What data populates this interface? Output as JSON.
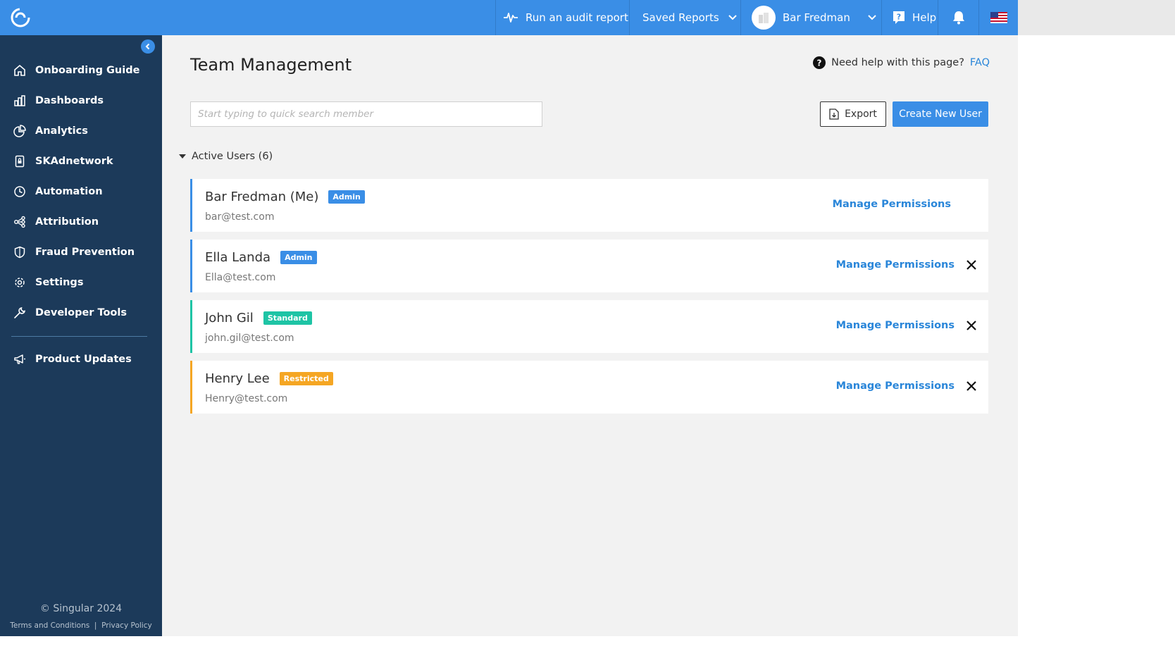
{
  "colors": {
    "brand": "#3a8ee6",
    "sidebar": "#1c3a5a",
    "admin": "#3a8ee6",
    "standard": "#1ec4a5",
    "restricted": "#f5a623",
    "link": "#2a86d9"
  },
  "topbar": {
    "audit_label": "Run an audit report",
    "saved_reports_label": "Saved Reports",
    "user_name": "Bar Fredman",
    "help_label": "Help"
  },
  "sidebar": {
    "items": [
      {
        "label": "Onboarding Guide",
        "icon": "home-icon"
      },
      {
        "label": "Dashboards",
        "icon": "bar-chart-icon"
      },
      {
        "label": "Analytics",
        "icon": "pie-chart-icon"
      },
      {
        "label": "SKAdnetwork",
        "icon": "lock-device-icon"
      },
      {
        "label": "Automation",
        "icon": "clock-icon"
      },
      {
        "label": "Attribution",
        "icon": "share-nodes-icon"
      },
      {
        "label": "Fraud Prevention",
        "icon": "shield-icon"
      },
      {
        "label": "Settings",
        "icon": "gear-icon"
      },
      {
        "label": "Developer Tools",
        "icon": "wrench-icon"
      }
    ],
    "updates_label": "Product Updates",
    "copyright": "© Singular 2024",
    "terms": "Terms and Conditions",
    "separator": "|",
    "privacy": "Privacy Policy"
  },
  "main": {
    "title": "Team Management",
    "help_text": "Need help with this page?",
    "faq": "FAQ",
    "search_placeholder": "Start typing to quick search member",
    "export_label": "Export",
    "create_label": "Create New User",
    "section_label": "Active Users (6)",
    "manage_label": "Manage Permissions",
    "users": [
      {
        "name": "Bar Fredman (Me)",
        "email": "bar@test.com",
        "role": "Admin",
        "color": "#3a8ee6",
        "removable": false
      },
      {
        "name": "Ella Landa",
        "email": "Ella@test.com",
        "role": "Admin",
        "color": "#3a8ee6",
        "removable": true
      },
      {
        "name": "John Gil",
        "email": "john.gil@test.com",
        "role": "Standard",
        "color": "#1ec4a5",
        "removable": true
      },
      {
        "name": "Henry Lee",
        "email": "Henry@test.com",
        "role": "Restricted",
        "color": "#f5a623",
        "removable": true
      }
    ]
  }
}
